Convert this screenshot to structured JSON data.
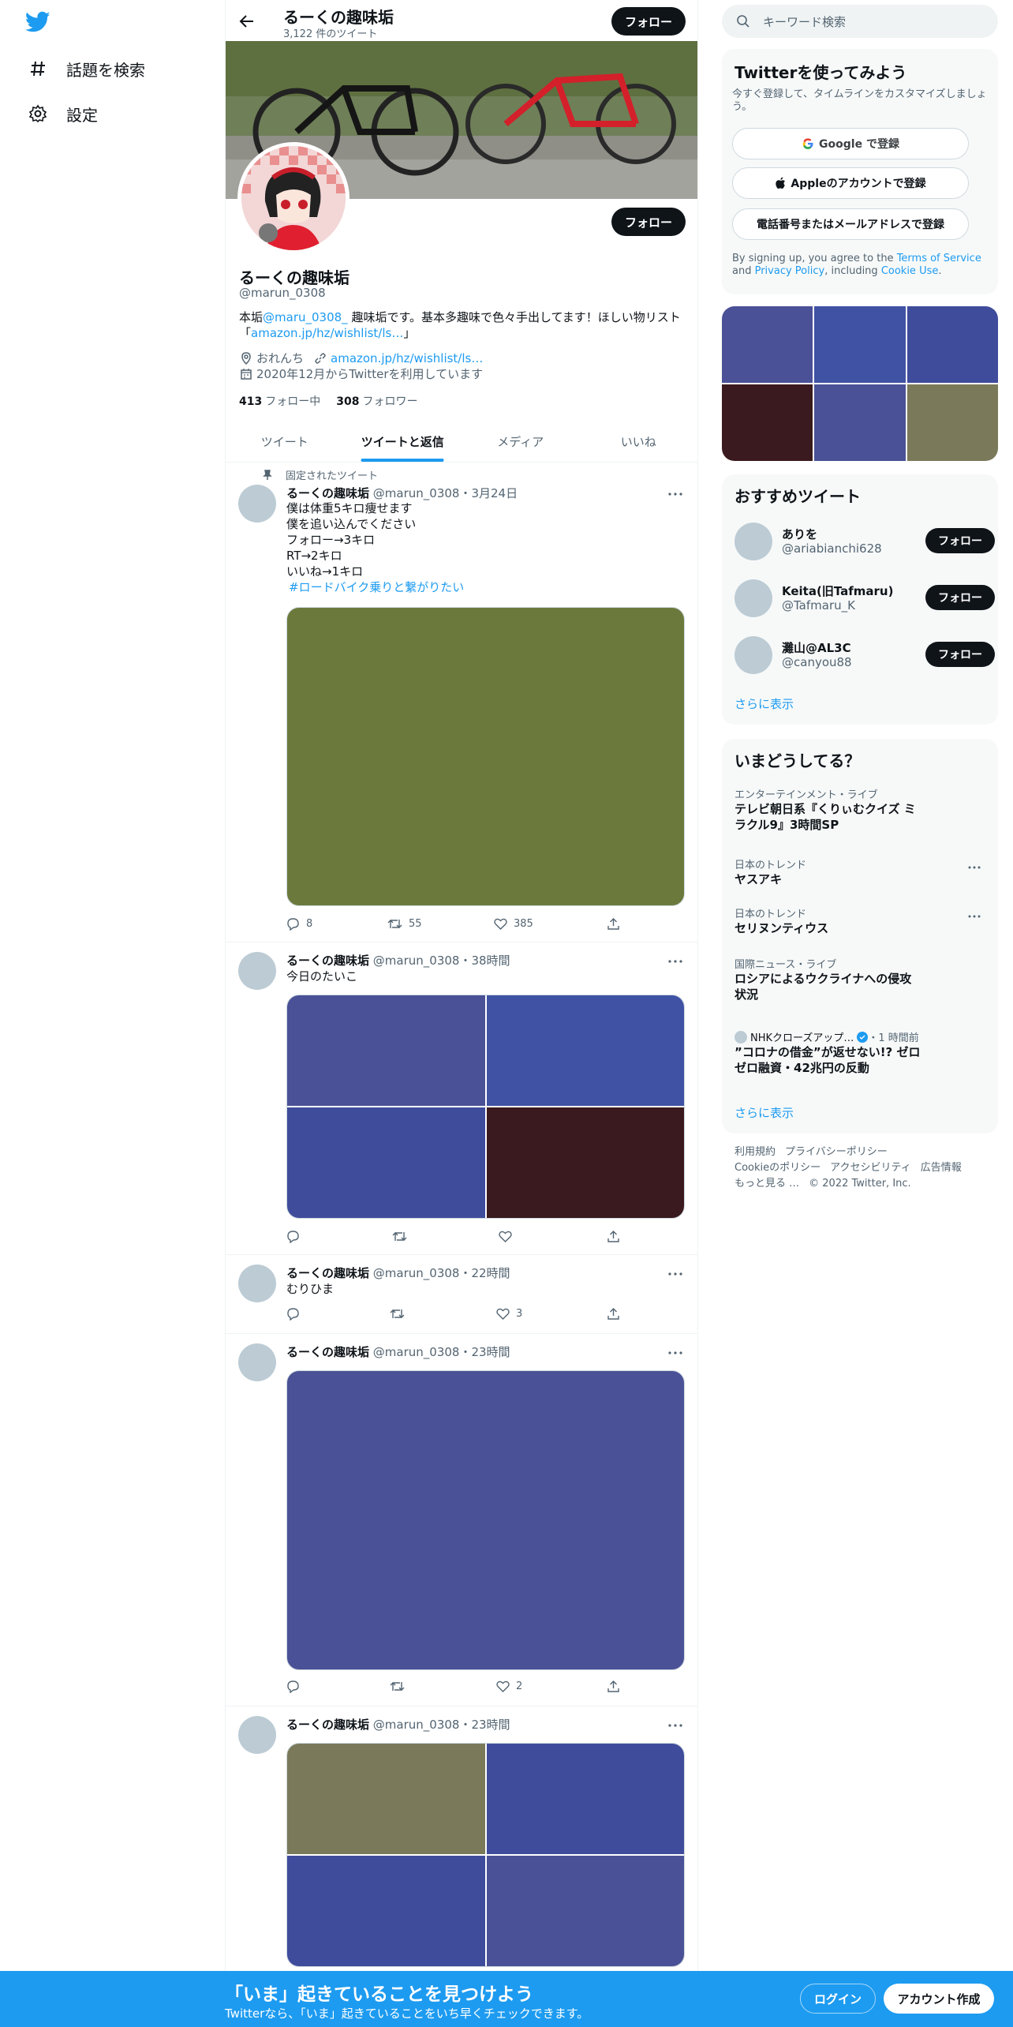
{
  "colors": {
    "accent": "#1d9bf0",
    "text": "#0f1419",
    "muted": "#536471",
    "button": "#0f1419"
  },
  "nav": {
    "explore_label": "話題を検索",
    "settings_label": "設定"
  },
  "header": {
    "title": "るーくの趣味垢",
    "tweet_count": "3,122 件のツイート",
    "follow_label": "フォロー"
  },
  "profile": {
    "name": "るーくの趣味垢",
    "handle": "@marun_0308",
    "follow_label": "フォロー",
    "bio_prefix": "本垢",
    "bio_mention": "@maru_0308_",
    "bio_rest": " 趣味垢です。基本多趣味で色々手出してます！ほしい物リスト「",
    "bio_link": "amazon.jp/hz/wishlist/ls…",
    "bio_suffix": "」",
    "location": "おれんち",
    "website": "amazon.jp/hz/wishlist/ls…",
    "joined": "2020年12月からTwitterを利用しています",
    "following_count": "413",
    "following_label": "フォロー中",
    "followers_count": "308",
    "followers_label": "フォロワー"
  },
  "tabs": [
    {
      "label": "ツイート"
    },
    {
      "label": "ツイートと返信"
    },
    {
      "label": "メディア"
    },
    {
      "label": "いいね"
    }
  ],
  "tweets": [
    {
      "pinned_label": "固定されたツイート",
      "name": "るーくの趣味垢",
      "meta": "@marun_0308・3月24日",
      "lines": [
        "僕は体重5キロ痩せます",
        "僕を追い込んでください",
        "フォロー→3キロ",
        "RT→2キロ",
        "いいね→1キロ"
      ],
      "hashtag": "#ロードバイク乗りと繋がりたい",
      "media_colors": [
        "#6b7a3c"
      ],
      "replies": "8",
      "retweets": "55",
      "likes": "385"
    },
    {
      "name": "るーくの趣味垢",
      "meta": "@marun_0308・38時間",
      "text": "今日のたいこ",
      "media_colors": [
        "#4a5196",
        "#3f52a3",
        "#3f4c9b",
        "#3a1a1e"
      ],
      "replies": "",
      "retweets": "",
      "likes": ""
    },
    {
      "name": "るーくの趣味垢",
      "meta": "@marun_0308・22時間",
      "text": "むりひま",
      "replies": "",
      "retweets": "",
      "likes": "3"
    },
    {
      "name": "るーくの趣味垢",
      "meta": "@marun_0308・23時間",
      "media_colors": [
        "#4a5196"
      ],
      "replies": "",
      "retweets": "",
      "likes": "2"
    },
    {
      "name": "るーくの趣味垢",
      "meta": "@marun_0308・23時間",
      "media_colors": [
        "#7a7a5a",
        "#3f4c9b",
        "#3f4c9b",
        "#4a5196"
      ]
    }
  ],
  "search": {
    "placeholder": "キーワード検索"
  },
  "signup": {
    "title": "Twitterを使ってみよう",
    "desc": "今すぐ登録して、タイムラインをカスタマイズしましょう。",
    "google_label": "Google で登録",
    "apple_label": "Appleのアカウントで登録",
    "phone_label": "電話番号またはメールアドレスで登録",
    "terms_prefix": "By signing up, you agree to the ",
    "terms_link": "Terms of Service",
    "terms_and": " and ",
    "privacy_link": "Privacy Policy",
    "terms_including": ", including ",
    "cookie_link": "Cookie Use",
    "terms_end": "."
  },
  "media_grid_colors": [
    "#4a5196",
    "#3f52a3",
    "#3f4c9b",
    "#3a1a1e",
    "#4a5196",
    "#7a7a5a"
  ],
  "recommend": {
    "title": "おすすめツイート",
    "users": [
      {
        "name": "ありを",
        "handle": "@ariabianchi628",
        "button": "フォロー"
      },
      {
        "name": "Keita(旧Tafmaru)",
        "handle": "@Tafmaru_K",
        "button": "フォロー"
      },
      {
        "name": "灘山@AL3C",
        "handle": "@canyou88",
        "button": "フォロー"
      }
    ],
    "more_label": "さらに表示"
  },
  "trends": {
    "title": "いまどうしてる？",
    "items": [
      {
        "category": "エンターテインメント・ライブ",
        "title": "テレビ朝日系『くりぃむクイズ ミラクル9』3時間SP"
      },
      {
        "category": "日本のトレンド",
        "title": "ヤスアキ"
      },
      {
        "category": "日本のトレンド",
        "title": "セリヌンティウス"
      },
      {
        "category": "国際ニュース・ライブ",
        "title": "ロシアによるウクライナへの侵攻状況"
      },
      {
        "source": "NHKクローズアップ…",
        "time": "・1 時間前",
        "title": "”コロナの借金”が返せない!? ゼロゼロ融資・42兆円の反動"
      }
    ],
    "more_label": "さらに表示"
  },
  "footer": {
    "links": [
      "利用規約",
      "プライバシーポリシー",
      "Cookieのポリシー",
      "アクセシビリティ",
      "広告情報",
      "もっと見る …"
    ],
    "copyright": "© 2022 Twitter, Inc."
  },
  "bottombar": {
    "title": "「いま」起きていることを見つけよう",
    "subtitle": "Twitterなら、「いま」起きていることをいち早くチェックできます。",
    "login_label": "ログイン",
    "signup_label": "アカウント作成"
  }
}
